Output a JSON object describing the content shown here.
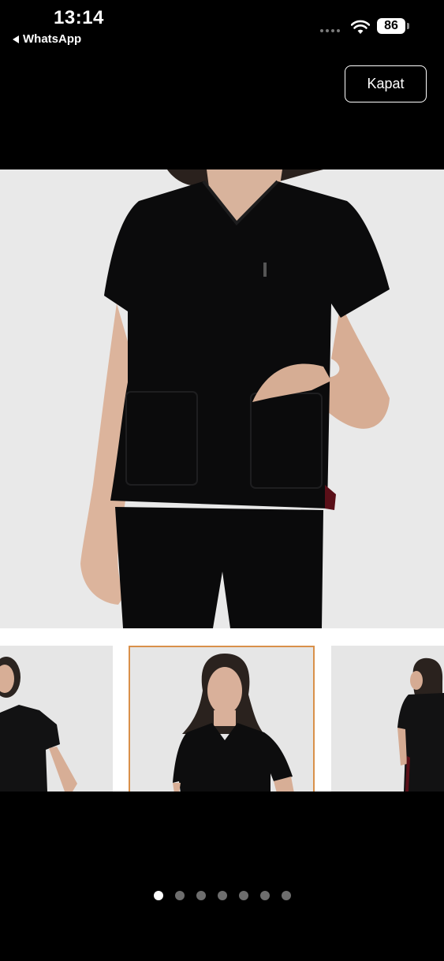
{
  "status_bar": {
    "time": "13:14",
    "back_app": "WhatsApp",
    "battery": "86"
  },
  "header": {
    "close_label": "Kapat"
  },
  "gallery": {
    "main_image_icon": "woman-black-scrub-top-photo",
    "thumbnails": [
      "scrub-front-left-photo",
      "scrub-front-photo",
      "scrub-back-photo"
    ],
    "selected_thumbnail": 2
  },
  "pager": {
    "total": 7,
    "active": 1
  },
  "colors": {
    "background": "#000000",
    "thumb_selected_border": "#d9904a",
    "dot_active": "#ffffff",
    "dot_inactive": "#6e6e6e"
  }
}
